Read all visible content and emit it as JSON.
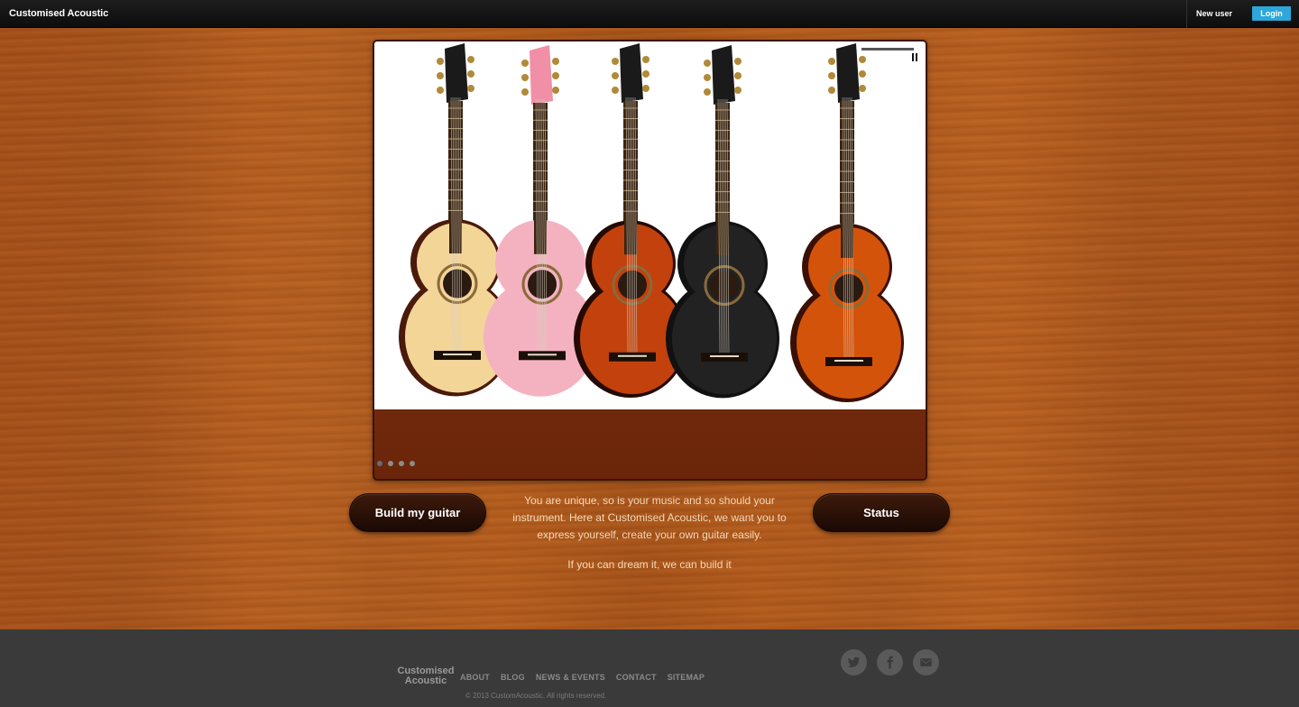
{
  "header": {
    "brand": "Customised Acoustic",
    "new_user": "New user",
    "login": "Login"
  },
  "slider": {
    "dots": 4,
    "active_dot": 0,
    "guitars": [
      {
        "icon": "natural-guitar-image",
        "body": "#f3d598",
        "edge": "#4a1a0a",
        "head": "#1a1a1a"
      },
      {
        "icon": "pink-guitar-image",
        "body": "#f4b2c0",
        "edge": "#f4b2c0",
        "head": "#f08fa6"
      },
      {
        "icon": "sunburst-guitar-image",
        "body": "#c2410c",
        "edge": "#240a04",
        "head": "#1a1a1a"
      },
      {
        "icon": "black-guitar-image",
        "body": "#222222",
        "edge": "#111111",
        "head": "#1a1a1a"
      },
      {
        "icon": "orange-guitar-image",
        "body": "#d4530a",
        "edge": "#3a1005",
        "head": "#1a1a1a"
      }
    ]
  },
  "main": {
    "build_button": "Build my guitar",
    "status_button": "Status",
    "intro": "You are unique, so is your music and so should your instrument. Here at Customised Acoustic, we want you to express yourself, create your own guitar easily.",
    "tagline": "If you can dream it, we can build it"
  },
  "footer": {
    "brand_line1": "Customised",
    "brand_line2": "Acoustic",
    "links": [
      "ABOUT",
      "BLOG",
      "NEWS & EVENTS",
      "CONTACT",
      "SITEMAP"
    ],
    "copyright": "© 2013 CustomAcoustic. All rights reserved.",
    "social": [
      "twitter-icon",
      "facebook-icon",
      "email-icon"
    ]
  },
  "colors": {
    "accent": "#2ea7da",
    "topbar": "#111111",
    "wood": "#b45d1a",
    "footer": "#3a3a3a"
  }
}
